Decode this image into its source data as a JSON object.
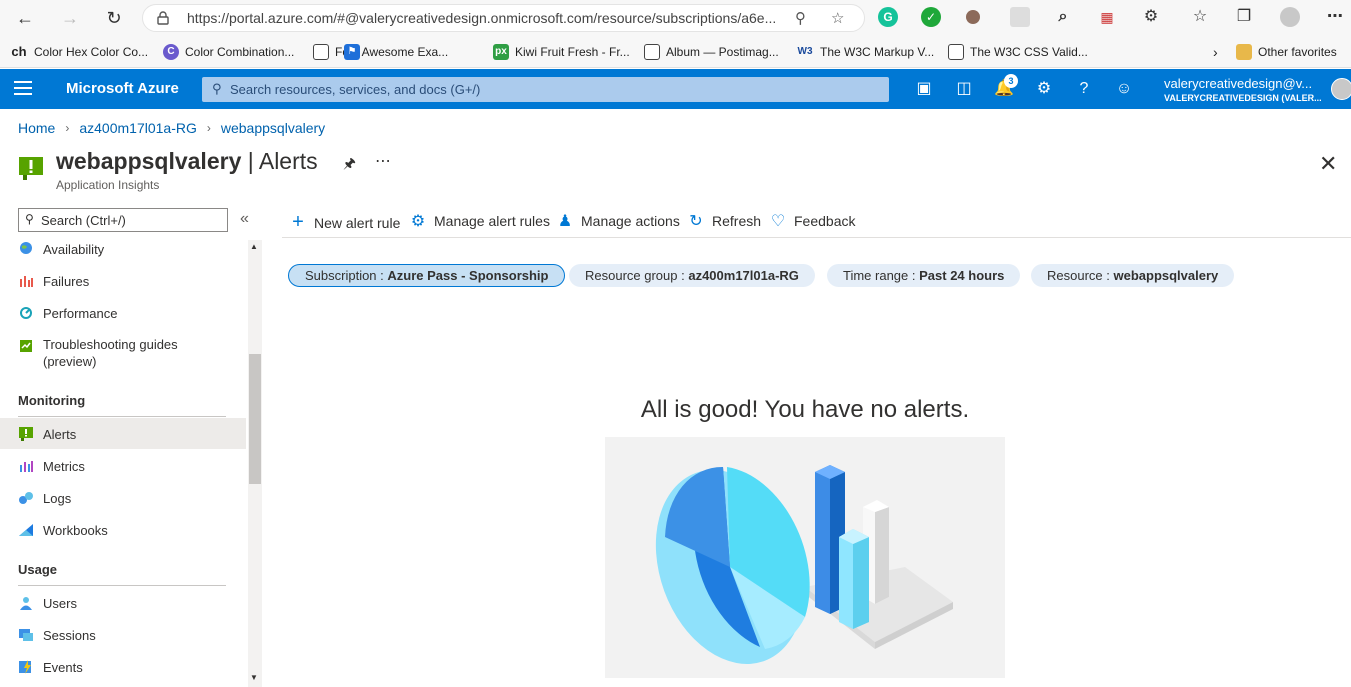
{
  "browser": {
    "url": "https://portal.azure.com/#@valerycreativedesign.onmicrosoft.com/resource/subscriptions/a6e...",
    "bookmarks": [
      {
        "label": "Color Hex Color Co...",
        "icon": "ch"
      },
      {
        "label": "Color Combination...",
        "icon": "C"
      },
      {
        "label": "Font Awesome Exa...",
        "icon": ""
      },
      {
        "label": "Kiwi Fruit Fresh - Fr...",
        "icon": "px"
      },
      {
        "label": "Album — Postimag...",
        "icon": ""
      },
      {
        "label": "The W3C Markup V...",
        "icon": "W3"
      },
      {
        "label": "The W3C CSS Valid...",
        "icon": ""
      }
    ],
    "other_favorites": "Other favorites"
  },
  "azure": {
    "brand": "Microsoft Azure",
    "search_placeholder": "Search resources, services, and docs (G+/)",
    "notification_count": "3",
    "account_email": "valerycreativedesign@v...",
    "account_directory": "VALERYCREATIVEDESIGN (VALER..."
  },
  "breadcrumb": [
    "Home",
    "az400m17l01a-RG",
    "webappsqlvalery"
  ],
  "page": {
    "resource_name": "webappsqlvalery",
    "blade_name": "Alerts",
    "separator": " | ",
    "subtitle": "Application Insights"
  },
  "sidebar": {
    "search_placeholder": "Search (Ctrl+/)",
    "items_top": [
      {
        "label": "Availability",
        "icon": "globe-icon"
      },
      {
        "label": "Failures",
        "icon": "failures-icon"
      },
      {
        "label": "Performance",
        "icon": "performance-icon"
      },
      {
        "label": "Troubleshooting guides (preview)",
        "icon": "guides-icon"
      }
    ],
    "sections": [
      {
        "title": "Monitoring",
        "items": [
          {
            "label": "Alerts",
            "icon": "alerts-icon",
            "active": true
          },
          {
            "label": "Metrics",
            "icon": "metrics-icon"
          },
          {
            "label": "Logs",
            "icon": "logs-icon"
          },
          {
            "label": "Workbooks",
            "icon": "workbooks-icon"
          }
        ]
      },
      {
        "title": "Usage",
        "items": [
          {
            "label": "Users",
            "icon": "users-icon"
          },
          {
            "label": "Sessions",
            "icon": "sessions-icon"
          },
          {
            "label": "Events",
            "icon": "events-icon"
          }
        ]
      }
    ]
  },
  "commands": [
    {
      "label": "New alert rule",
      "icon": "plus-icon"
    },
    {
      "label": "Manage alert rules",
      "icon": "gear-icon"
    },
    {
      "label": "Manage actions",
      "icon": "people-icon"
    },
    {
      "label": "Refresh",
      "icon": "refresh-icon"
    },
    {
      "label": "Feedback",
      "icon": "heart-icon"
    }
  ],
  "filters": [
    {
      "key": "Subscription",
      "value": "Azure Pass - Sponsorship",
      "selected": true
    },
    {
      "key": "Resource group",
      "value": "az400m17l01a-RG"
    },
    {
      "key": "Time range",
      "value": "Past 24 hours"
    },
    {
      "key": "Resource",
      "value": "webappsqlvalery"
    }
  ],
  "filter_separator": " : ",
  "empty_state": {
    "message": "All is good! You have no alerts."
  },
  "colors": {
    "azure_blue": "#0078d4",
    "link": "#0062ad",
    "alert_green": "#57a300"
  }
}
